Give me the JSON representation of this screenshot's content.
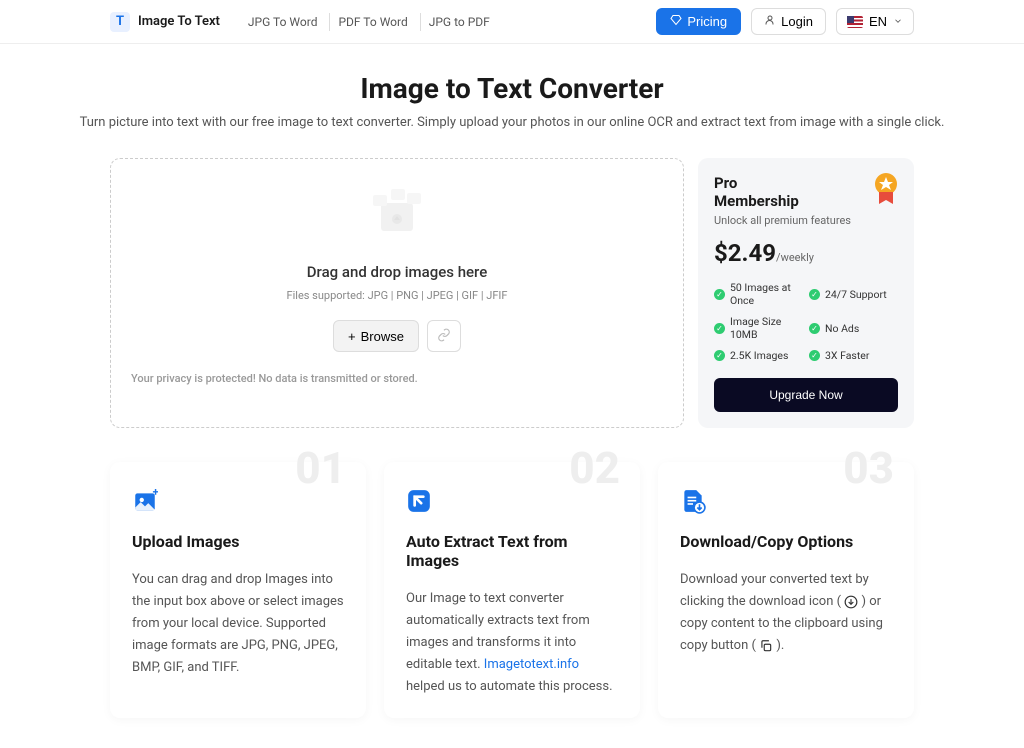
{
  "header": {
    "logo_text": "Image To Text",
    "nav": [
      {
        "label": "JPG To Word"
      },
      {
        "label": "PDF To Word"
      },
      {
        "label": "JPG to PDF"
      }
    ],
    "pricing": "Pricing",
    "login": "Login",
    "lang": "EN"
  },
  "hero": {
    "title": "Image to Text Converter",
    "subtitle": "Turn picture into text with our free image to text converter. Simply upload your photos in our online OCR and extract text from image with a single click."
  },
  "upload": {
    "drop_text": "Drag and drop images here",
    "formats": "Files supported: JPG | PNG | JPEG | GIF | JFIF",
    "browse": "Browse",
    "privacy": "Your privacy is protected! No data is transmitted or stored."
  },
  "membership": {
    "title_line1": "Pro",
    "title_line2": "Membership",
    "subtitle": "Unlock all premium features",
    "price": "$2.49",
    "period": "/weekly",
    "features": [
      "50 Images at Once",
      "24/7 Support",
      "Image Size 10MB",
      "No Ads",
      "2.5K Images",
      "3X Faster"
    ],
    "cta": "Upgrade Now"
  },
  "steps": [
    {
      "num": "01",
      "title": "Upload Images",
      "desc": "You can drag and drop Images into the input box above or select images from your local device. Supported image formats are JPG, PNG, JPEG, BMP, GIF, and TIFF."
    },
    {
      "num": "02",
      "title": "Auto Extract Text from Images",
      "desc_pre": "Our Image to text converter automatically extracts text from images and transforms it into editable text. ",
      "link_text": "Imagetotext.info",
      "desc_post": " helped us to automate this process."
    },
    {
      "num": "03",
      "title": "Download/Copy Options",
      "desc_pre": "Download your converted text by clicking the download icon ( ",
      "desc_mid": " ) or copy content to the clipboard using copy button ( ",
      "desc_post": " )."
    }
  ]
}
